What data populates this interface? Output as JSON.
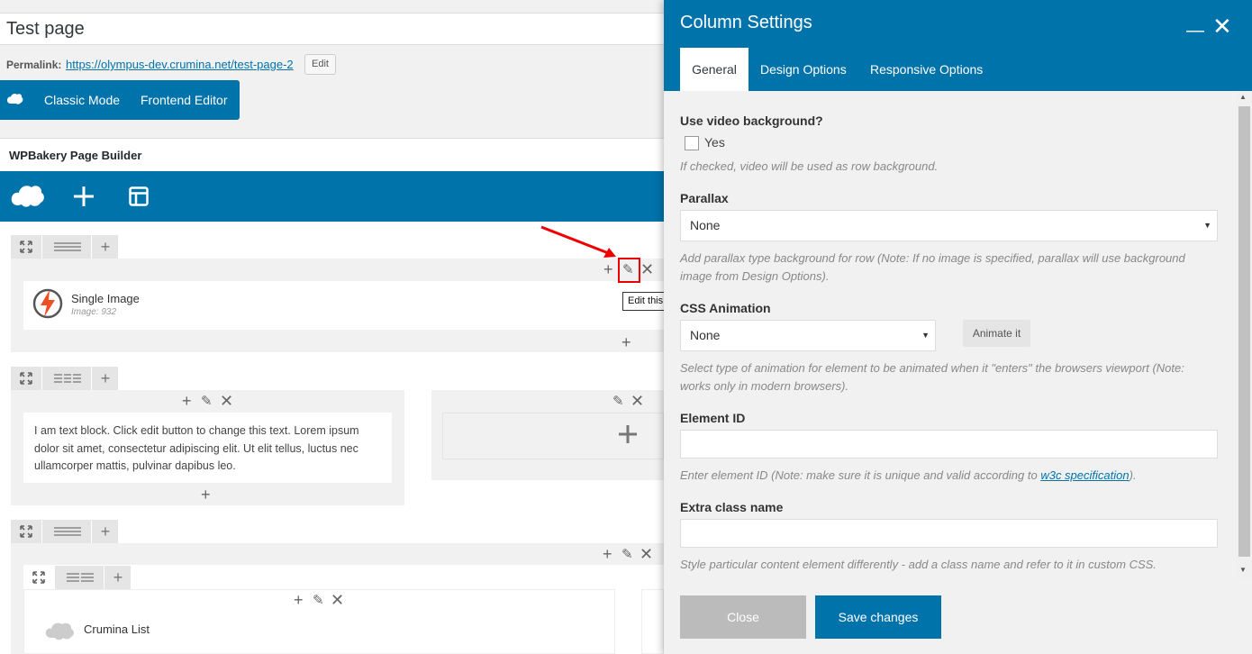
{
  "editor": {
    "title": "Test page",
    "permalink_label": "Permalink:",
    "permalink_url": "https://olympus-dev.crumina.net/test-page-2",
    "permalink_edit": "Edit"
  },
  "mode_bar": {
    "classic": "Classic Mode",
    "frontend": "Frontend Editor"
  },
  "wpbakery": {
    "title": "WPBakery Page Builder"
  },
  "rows": [
    {
      "element_title": "Single Image",
      "element_sub": "Image: 932"
    },
    {
      "text_block": "I am text block. Click edit button to change this text. Lorem ipsum dolor sit amet, consectetur adipiscing elit. Ut elit tellus, luctus nec ullamcorper mattis, pulvinar dapibus leo."
    },
    {
      "element_title": "Crumina List"
    }
  ],
  "tooltip": "Edit this column",
  "modal": {
    "title": "Column Settings",
    "tabs": [
      "General",
      "Design Options",
      "Responsive Options"
    ],
    "video_bg_label": "Use video background?",
    "video_bg_option": "Yes",
    "video_bg_help": "If checked, video will be used as row background.",
    "parallax_label": "Parallax",
    "parallax_value": "None",
    "parallax_help": "Add parallax type background for row (Note: If no image is specified, parallax will use background image from Design Options).",
    "css_anim_label": "CSS Animation",
    "css_anim_value": "None",
    "animate_btn": "Animate it",
    "css_anim_help": "Select type of animation for element to be animated when it \"enters\" the browsers viewport (Note: works only in modern browsers).",
    "element_id_label": "Element ID",
    "element_id_help_pre": "Enter element ID (Note: make sure it is unique and valid according to ",
    "element_id_help_link": "w3c specification",
    "element_id_help_post": ").",
    "extra_class_label": "Extra class name",
    "extra_class_help": "Style particular content element differently - add a class name and refer to it in custom CSS.",
    "close_btn": "Close",
    "save_btn": "Save changes"
  },
  "colors": {
    "accent": "#0073aa",
    "highlight": "#e00000"
  }
}
